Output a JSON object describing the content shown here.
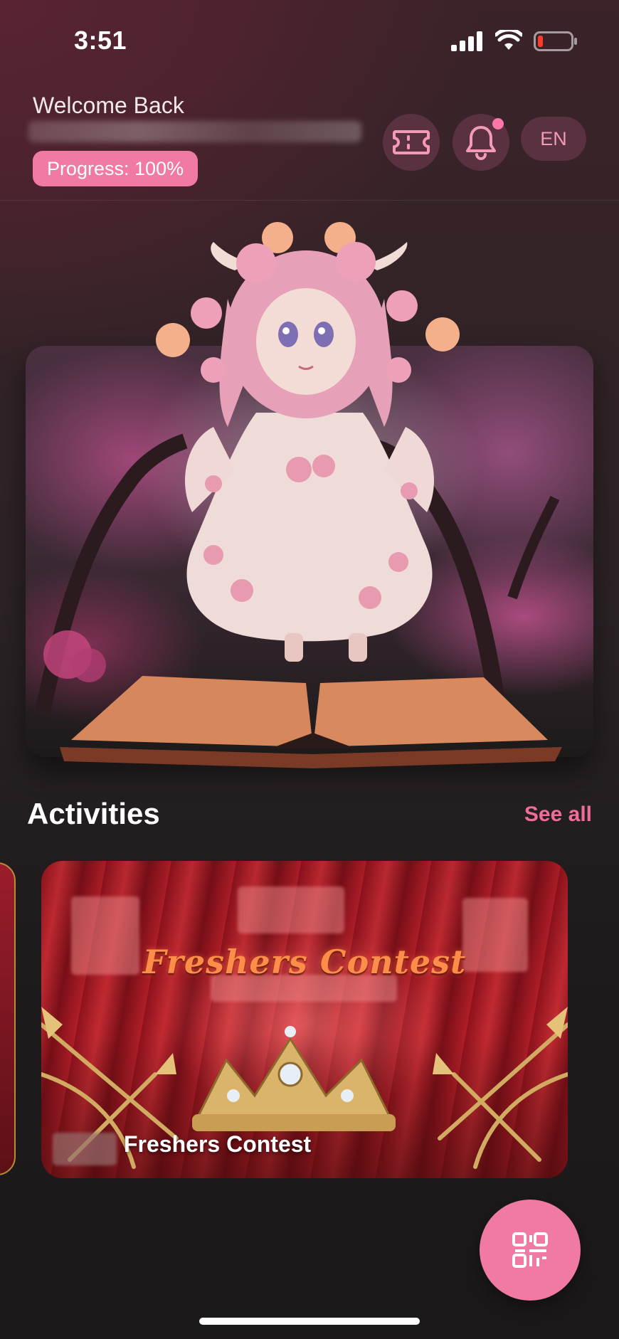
{
  "status_bar": {
    "time": "3:51",
    "icons": [
      "signal-icon",
      "wifi-icon",
      "battery-low-icon"
    ]
  },
  "header": {
    "welcome": "Welcome Back",
    "progress_label": "Progress: 100%",
    "progress_value": 1.0,
    "language": "EN",
    "has_notification": true,
    "icons": [
      "ticket-icon",
      "bell-icon"
    ]
  },
  "hero": {
    "image": "pink-flower-doll-on-open-book-banner"
  },
  "activities": {
    "title": "Activities",
    "see_all": "See all",
    "cards": [
      {
        "heading": "Freshers Contest",
        "title": "Freshers Contest"
      }
    ]
  },
  "fab": {
    "icon": "qr-code-icon"
  },
  "colors": {
    "accent": "#f07aa3",
    "accent_text": "#f06d9b",
    "button_bg": "#5a3140"
  }
}
